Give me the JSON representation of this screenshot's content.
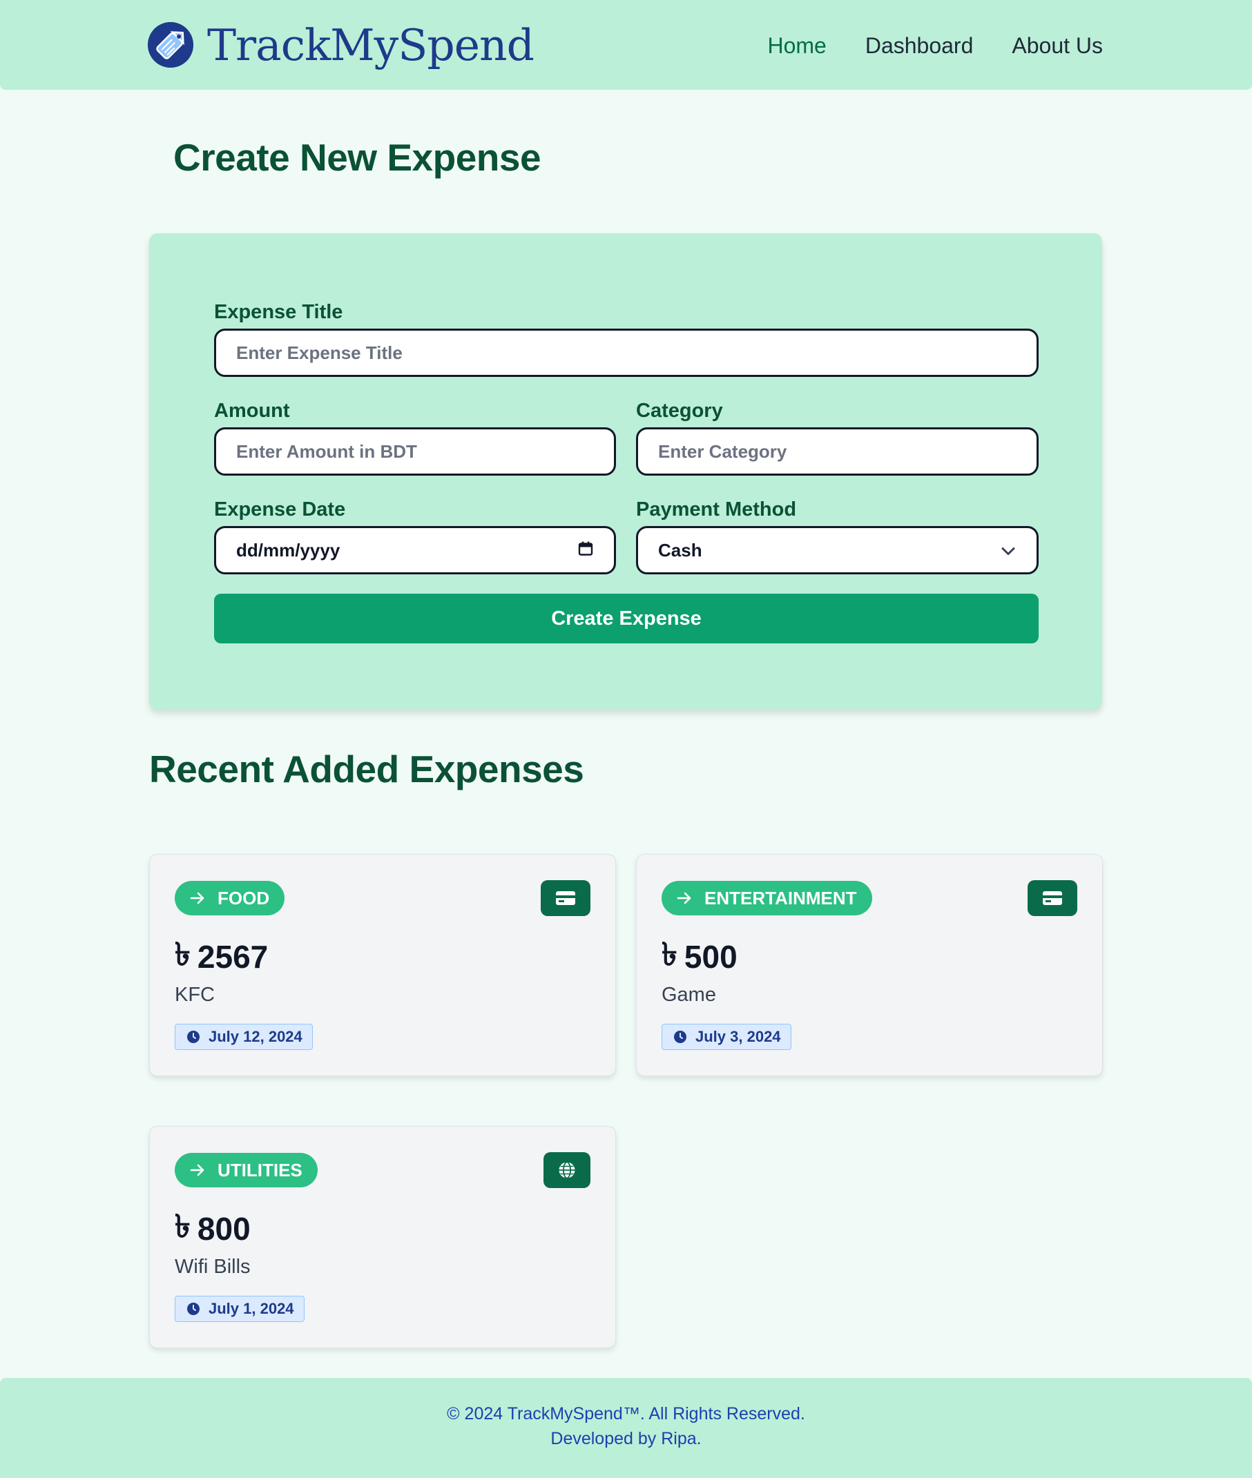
{
  "brand": {
    "name": "TrackMySpend",
    "logo_icon": "price-tag-icon"
  },
  "nav": [
    {
      "label": "Home",
      "active": true
    },
    {
      "label": "Dashboard",
      "active": false
    },
    {
      "label": "About Us",
      "active": false
    }
  ],
  "form": {
    "heading": "Create New Expense",
    "title_label": "Expense Title",
    "title_placeholder": "Enter Expense Title",
    "amount_label": "Amount",
    "amount_placeholder": "Enter Amount in BDT",
    "category_label": "Category",
    "category_placeholder": "Enter Category",
    "date_label": "Expense Date",
    "date_placeholder": "dd/mm/yyyy",
    "payment_label": "Payment Method",
    "payment_value": "Cash",
    "submit_label": "Create Expense"
  },
  "recent": {
    "heading": "Recent Added Expenses",
    "currency_symbol": "৳",
    "items": [
      {
        "category": "FOOD",
        "amount": "2567",
        "title": "KFC",
        "date": "July 12, 2024",
        "payment_icon": "credit-card-icon"
      },
      {
        "category": "ENTERTAINMENT",
        "amount": "500",
        "title": "Game",
        "date": "July 3, 2024",
        "payment_icon": "credit-card-icon"
      },
      {
        "category": "UTILITIES",
        "amount": "800",
        "title": "Wifi Bills",
        "date": "July 1, 2024",
        "payment_icon": "globe-icon"
      }
    ]
  },
  "footer": {
    "copyright": "© 2024 TrackMySpend™. All Rights Reserved.",
    "credit": "Developed by Ripa."
  },
  "colors": {
    "header_bg": "#bbefd8",
    "page_bg": "#f0faf6",
    "heading_green": "#0b5135",
    "button_green": "#0ca06e",
    "pill_green": "#2cc084",
    "badge_green": "#0a6b4a",
    "brand_blue": "#1e3a8a"
  }
}
